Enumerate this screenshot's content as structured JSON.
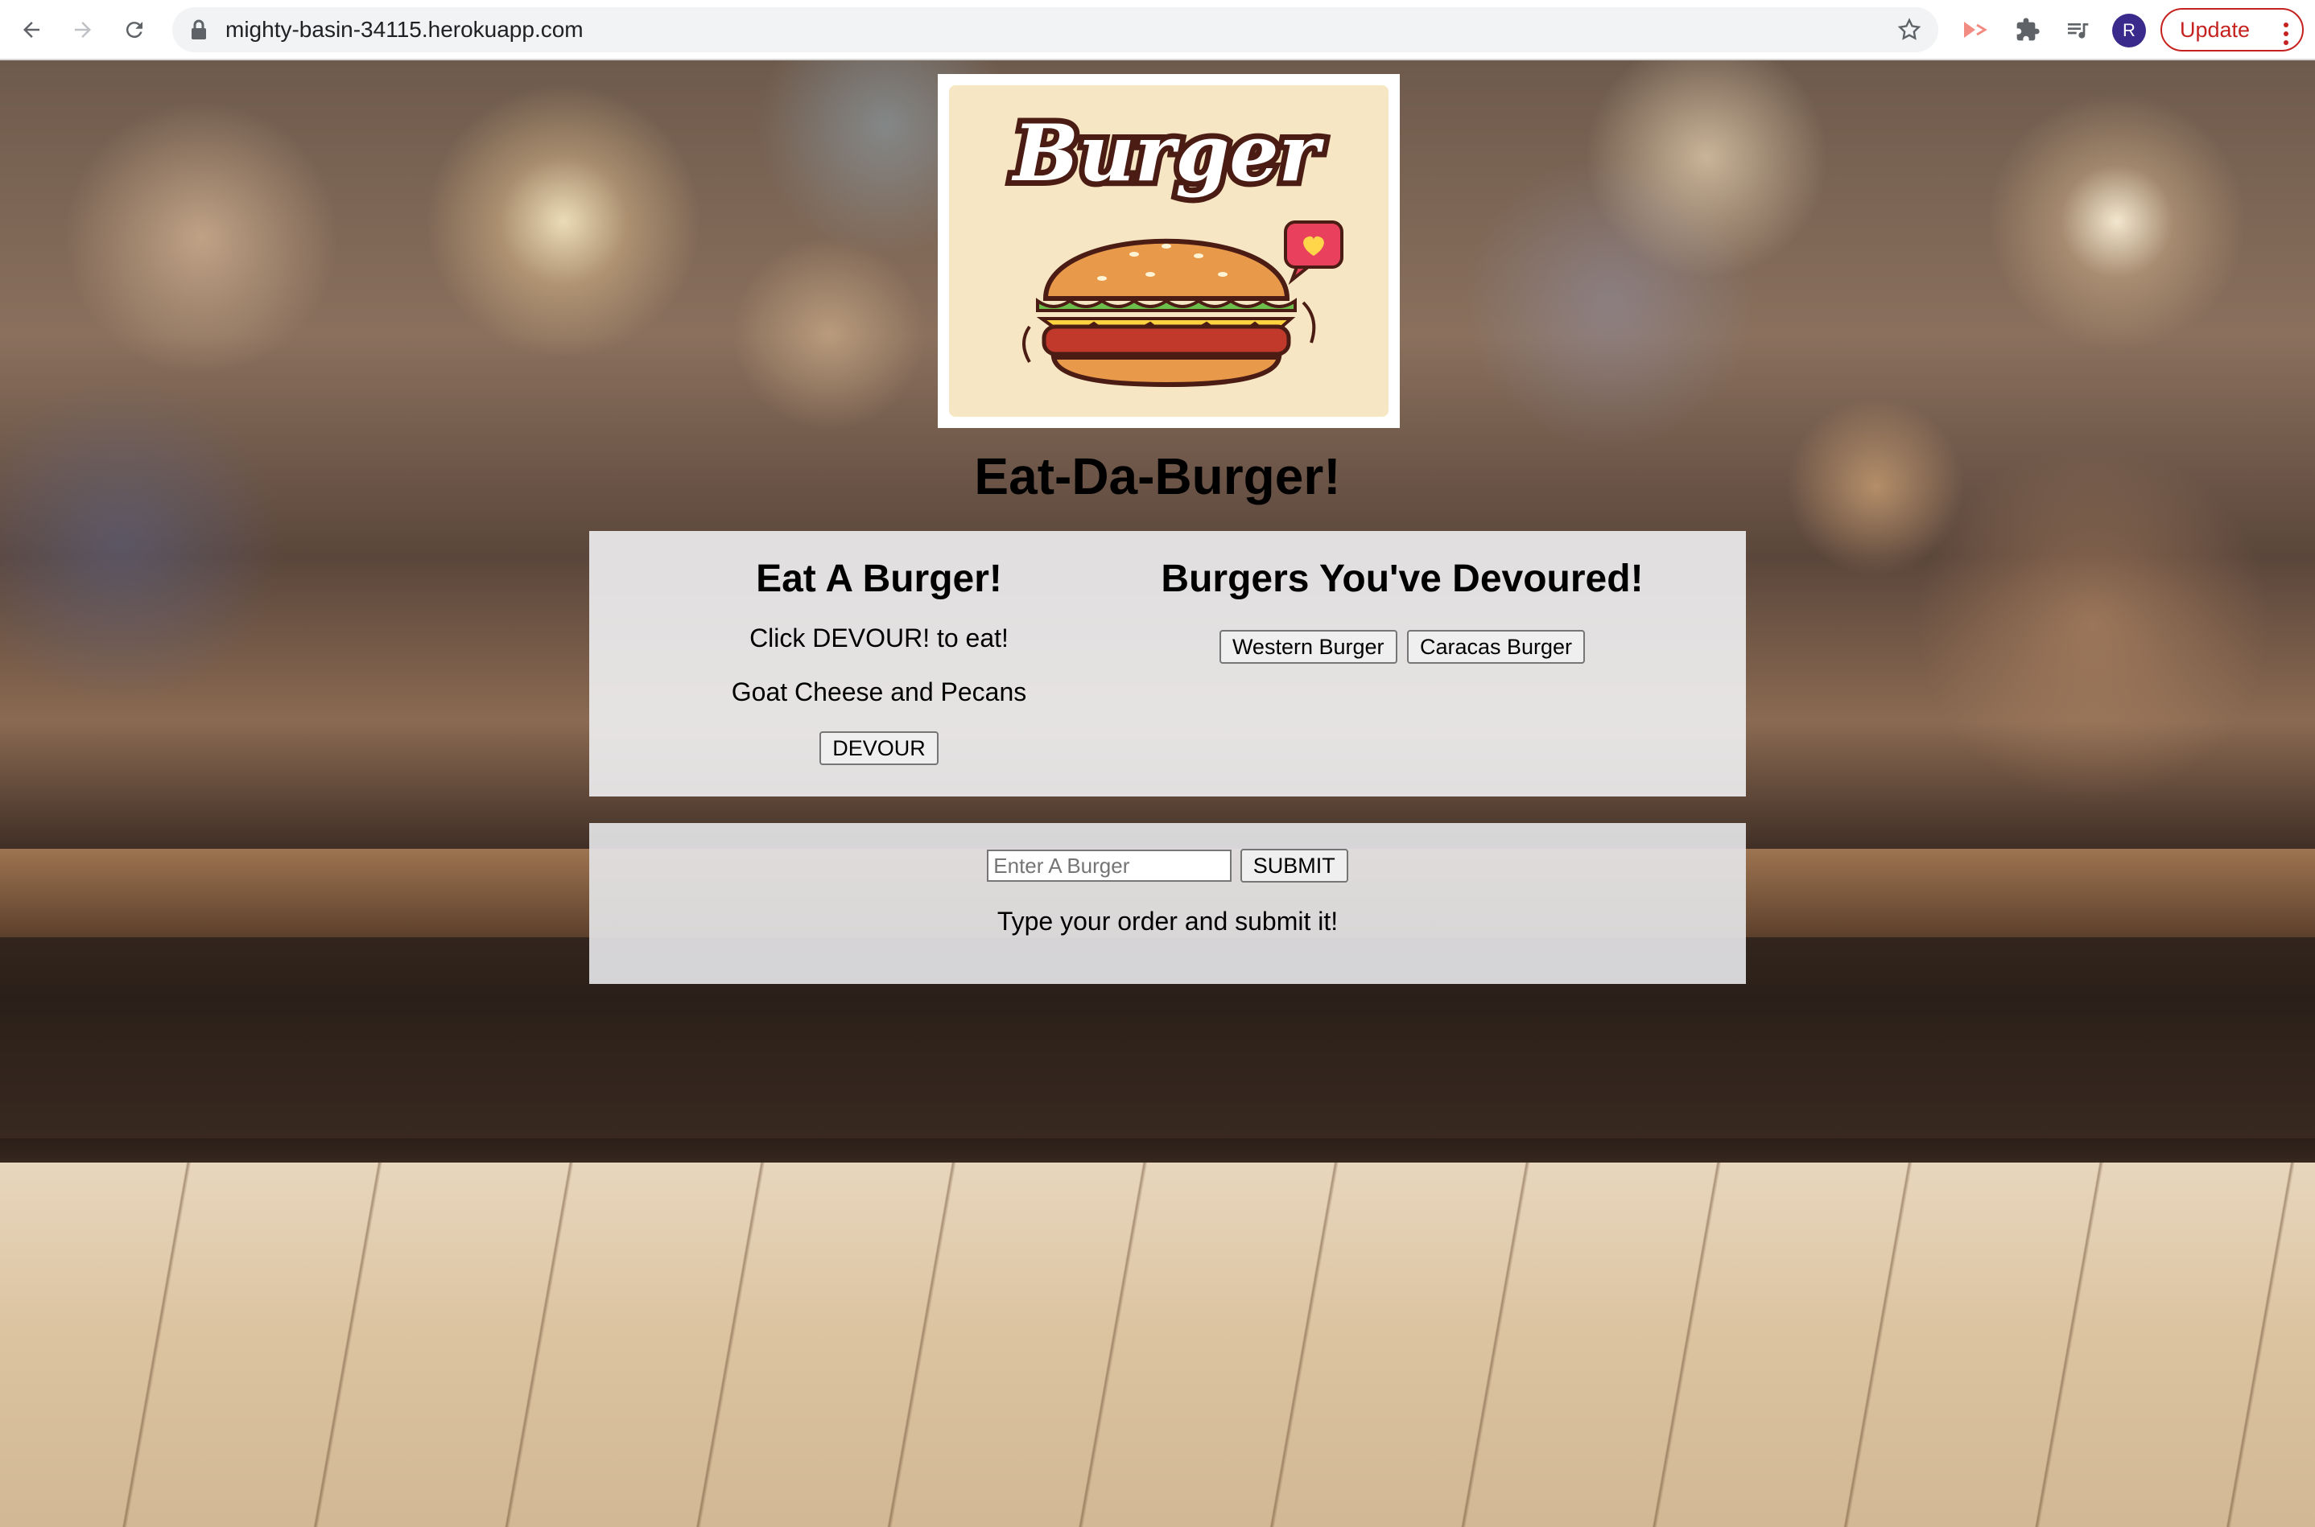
{
  "browser": {
    "url": "mighty-basin-34115.herokuapp.com",
    "avatar_letter": "R",
    "update_label": "Update"
  },
  "page": {
    "logo_text": "Burger",
    "title": "Eat-Da-Burger!"
  },
  "eat_section": {
    "heading": "Eat A Burger!",
    "instruction": "Click DEVOUR! to eat!",
    "items": [
      {
        "name": "Goat Cheese and Pecans",
        "button_label": "DEVOUR"
      }
    ]
  },
  "devoured_section": {
    "heading": "Burgers You've Devoured!",
    "items": [
      "Western Burger",
      "Caracas Burger"
    ]
  },
  "order_form": {
    "placeholder": "Enter A Burger",
    "submit_label": "SUBMIT",
    "hint": "Type your order and submit it!"
  },
  "colors": {
    "update_red": "#c5221f",
    "avatar_purple": "#3a2a8c",
    "logo_bg": "#f7e6c3"
  }
}
